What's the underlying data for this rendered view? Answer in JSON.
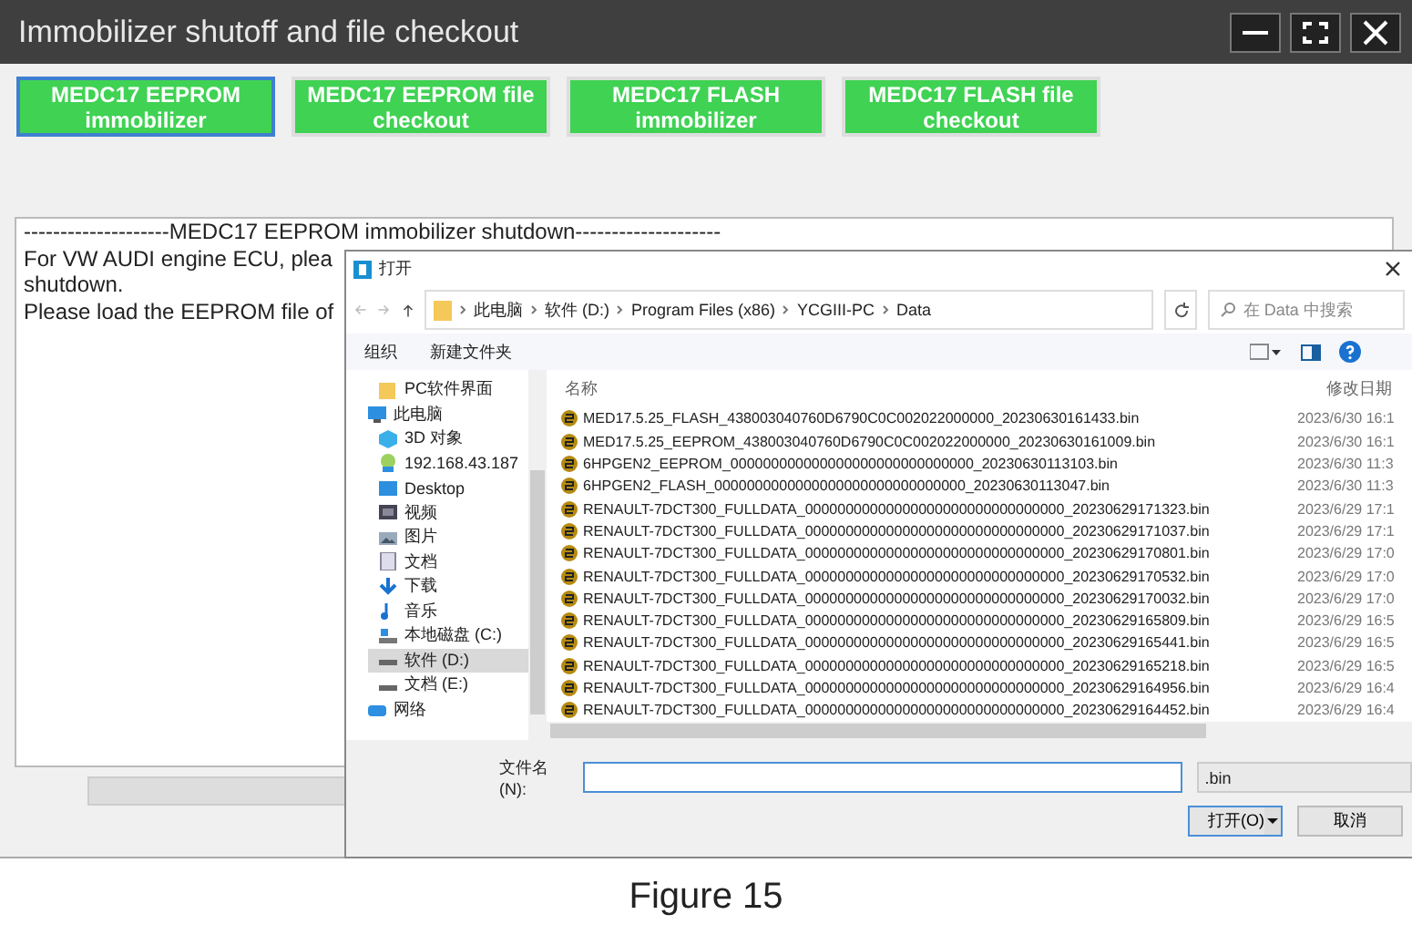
{
  "window": {
    "title": "Immobilizer shutoff and file checkout"
  },
  "mode_buttons": [
    {
      "label": "MEDC17 EEPROM immobilizer",
      "selected": true
    },
    {
      "label": "MEDC17 EEPROM file checkout",
      "selected": false
    },
    {
      "label": "MEDC17 FLASH immobilizer",
      "selected": false
    },
    {
      "label": "MEDC17 FLASH file checkout",
      "selected": false
    }
  ],
  "log": {
    "lines": [
      "--------------------MEDC17 EEPROM immobilizer shutdown--------------------",
      "For VW AUDI engine ECU, plea",
      "shutdown.",
      "Please load the EEPROM file of"
    ]
  },
  "progress": {
    "level": 0
  },
  "open_dialog": {
    "title": "打开",
    "breadcrumb": [
      "此电脑",
      "软件 (D:)",
      "Program Files (x86)",
      "YCGIII-PC",
      "Data"
    ],
    "search_placeholder": "在 Data 中搜索",
    "organize": "组织",
    "new_folder": "新建文件夹",
    "nav_items": [
      {
        "label": "PC软件界面",
        "kind": "folder",
        "selected": false
      },
      {
        "label": "此电脑",
        "kind": "pc",
        "selected": false
      },
      {
        "label": "3D 对象",
        "kind": "cube",
        "selected": false
      },
      {
        "label": "192.168.43.187",
        "kind": "netdrive",
        "selected": false
      },
      {
        "label": "Desktop",
        "kind": "desktop",
        "selected": false
      },
      {
        "label": "视频",
        "kind": "video",
        "selected": false
      },
      {
        "label": "图片",
        "kind": "pictures",
        "selected": false
      },
      {
        "label": "文档",
        "kind": "documents",
        "selected": false
      },
      {
        "label": "下载",
        "kind": "download",
        "selected": false
      },
      {
        "label": "音乐",
        "kind": "music",
        "selected": false
      },
      {
        "label": "本地磁盘 (C:)",
        "kind": "system",
        "selected": false
      },
      {
        "label": "软件 (D:)",
        "kind": "drive",
        "selected": true
      },
      {
        "label": "文档 (E:)",
        "kind": "drive",
        "selected": false
      },
      {
        "label": "网络",
        "kind": "network",
        "selected": false
      }
    ],
    "columns": [
      "名称",
      "修改日期"
    ],
    "files": [
      {
        "name": "MED17.5.25_FLASH_438003040760D6790C0C002022000000_20230630161433.bin",
        "date": "2023/6/30 16:1"
      },
      {
        "name": "MED17.5.25_EEPROM_438003040760D6790C0C002022000000_20230630161009.bin",
        "date": "2023/6/30 16:1"
      },
      {
        "name": "6HPGEN2_EEPROM_000000000000000000000000000000_20230630113103.bin",
        "date": "2023/6/30 11:3"
      },
      {
        "name": "6HPGEN2_FLASH_0000000000000000000000000000000_20230630113047.bin",
        "date": "2023/6/30 11:3"
      },
      {
        "name": "RENAULT-7DCT300_FULLDATA_00000000000000000000000000000000_20230629171323.bin",
        "date": "2023/6/29 17:1"
      },
      {
        "name": "RENAULT-7DCT300_FULLDATA_00000000000000000000000000000000_20230629171037.bin",
        "date": "2023/6/29 17:1"
      },
      {
        "name": "RENAULT-7DCT300_FULLDATA_00000000000000000000000000000000_20230629170801.bin",
        "date": "2023/6/29 17:0"
      },
      {
        "name": "RENAULT-7DCT300_FULLDATA_00000000000000000000000000000000_20230629170532.bin",
        "date": "2023/6/29 17:0"
      },
      {
        "name": "RENAULT-7DCT300_FULLDATA_00000000000000000000000000000000_20230629170032.bin",
        "date": "2023/6/29 17:0"
      },
      {
        "name": "RENAULT-7DCT300_FULLDATA_00000000000000000000000000000000_20230629165809.bin",
        "date": "2023/6/29 16:5"
      },
      {
        "name": "RENAULT-7DCT300_FULLDATA_00000000000000000000000000000000_20230629165441.bin",
        "date": "2023/6/29 16:5"
      },
      {
        "name": "RENAULT-7DCT300_FULLDATA_00000000000000000000000000000000_20230629165218.bin",
        "date": "2023/6/29 16:5"
      },
      {
        "name": "RENAULT-7DCT300_FULLDATA_00000000000000000000000000000000_20230629164956.bin",
        "date": "2023/6/29 16:4"
      },
      {
        "name": "RENAULT-7DCT300_FULLDATA_00000000000000000000000000000000_20230629164452.bin",
        "date": "2023/6/29 16:4"
      }
    ],
    "filename_label": "文件名(N):",
    "filter": ".bin",
    "open_button": "打开(O)",
    "cancel_button": "取消"
  },
  "caption": "Figure 15"
}
